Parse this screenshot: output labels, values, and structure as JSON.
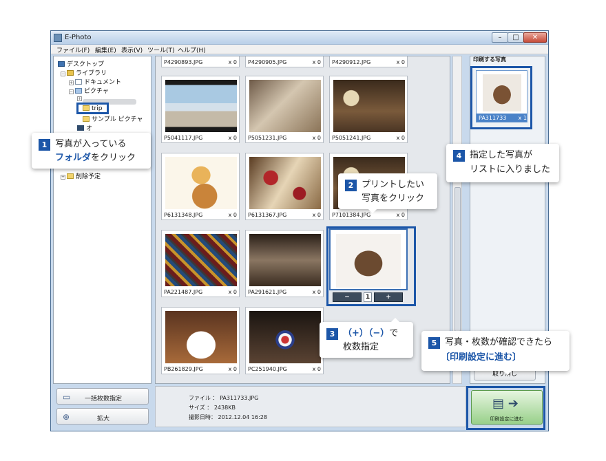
{
  "window": {
    "title": "E-Photo",
    "controls": {
      "minimize": "–",
      "maximize": "□",
      "close": "✕"
    }
  },
  "menubar": [
    "ファイル(F)",
    "編集(E)",
    "表示(V)",
    "ツール(T)",
    "ヘルプ(H)"
  ],
  "tree": {
    "items": [
      "デスクトップ",
      "ライブラリ",
      "ドキュメント",
      "ピクチャ",
      "trip",
      "サンプル ピクチャ",
      "オ",
      "削除予定"
    ]
  },
  "left_buttons": {
    "bulk_count": "一括枚数指定",
    "zoom": "拡大"
  },
  "photos": [
    {
      "file": "P4290893.JPG",
      "count": "x 0"
    },
    {
      "file": "P4290905.JPG",
      "count": "x 0"
    },
    {
      "file": "P4290912.JPG",
      "count": "x 0"
    },
    {
      "file": "P5041117.JPG",
      "count": "x 0"
    },
    {
      "file": "P5051231.JPG",
      "count": "x 0"
    },
    {
      "file": "P5051241.JPG",
      "count": "x 0"
    },
    {
      "file": "P6131348.JPG",
      "count": "x 0"
    },
    {
      "file": "P6131367.JPG",
      "count": "x 0"
    },
    {
      "file": "P7101384.JPG",
      "count": "x 0"
    },
    {
      "file": "PA221487.JPG",
      "count": "x 0"
    },
    {
      "file": "PA291621.JPG",
      "count": "x 0"
    },
    {
      "file": "PB261829.JPG",
      "count": "x 0"
    },
    {
      "file": "PC251940.JPG",
      "count": "x 0"
    }
  ],
  "selected": {
    "minus": "−",
    "count": "1",
    "plus": "+"
  },
  "print_list": {
    "title": "印刷する写真",
    "item": {
      "file": "PA311733",
      "count": "x 1"
    },
    "remove": "取り消し"
  },
  "info": {
    "file": "ファイル ： PA311733.JPG",
    "size": "サイズ ： 2438KB",
    "date": "撮影日時： 2012.12.04  16:28"
  },
  "proceed_button": "印刷設定に進む",
  "callouts": {
    "c1": {
      "num": "1",
      "line1": "写真が入っている",
      "line2_blue": "フォルダ",
      "line2_rest": "をクリック"
    },
    "c2": {
      "num": "2",
      "line1": "プリントしたい",
      "line2": "写真をクリック"
    },
    "c3": {
      "num": "3",
      "line1_blue": "（+）（−）",
      "line1_rest": "で",
      "line2": "枚数指定"
    },
    "c4": {
      "num": "4",
      "line1": "指定した写真が",
      "line2": "リストに入りました"
    },
    "c5": {
      "num": "5",
      "line1": "写真・枚数が確認できたら",
      "line2_blue": "〔印刷設定に進む〕"
    }
  }
}
